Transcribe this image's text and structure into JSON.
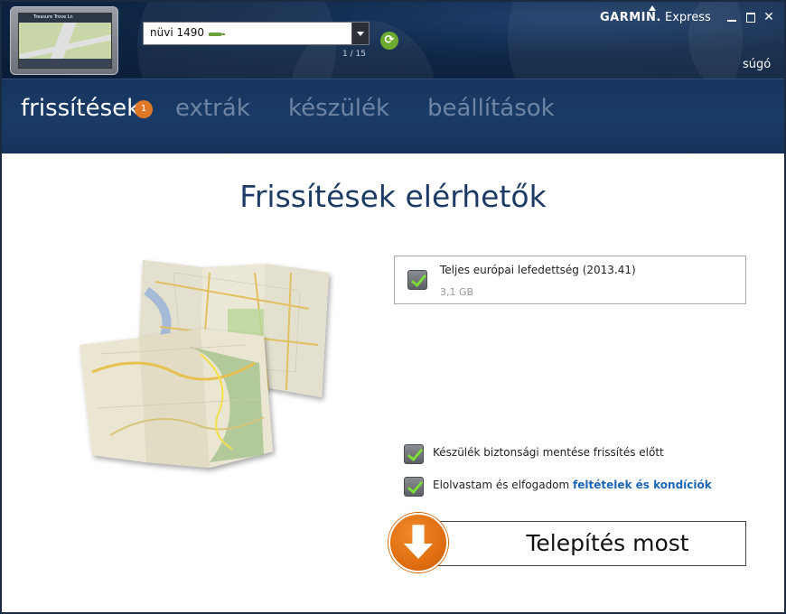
{
  "header": {
    "device_name": "nüvi 1490",
    "device_count": "1 / 15",
    "brand_name": "GARMIN.",
    "brand_product": "Express",
    "help_label": "súgó",
    "device_thumb_text": "Treasure Trove Ln"
  },
  "nav": {
    "tabs": [
      {
        "label": "frissítések",
        "active": true
      },
      {
        "label": "extrák",
        "active": false
      },
      {
        "label": "készülék",
        "active": false
      },
      {
        "label": "beállítások",
        "active": false
      }
    ],
    "updates_badge": "1"
  },
  "main": {
    "title": "Frissítések elérhetők",
    "update_item": {
      "name": "Teljes európai lefedettség (2013.41)",
      "size": "3,1 GB",
      "checked": true
    },
    "backup_option": {
      "label": "Készülék biztonsági mentése frissítés előtt",
      "checked": true
    },
    "terms_option": {
      "prefix": "Elolvastam és elfogadom ",
      "link": "feltételek és kondíciók",
      "checked": true
    },
    "install_button": "Telepítés most"
  },
  "colors": {
    "header_bg": "#0f2748",
    "nav_bg": "#1a3b67",
    "accent_orange": "#e06f10",
    "title_blue": "#1b3a64",
    "link_blue": "#1d66b5",
    "check_green": "#7ddc3a",
    "sync_green": "#6cab2d"
  },
  "icons": {
    "sync": "refresh-icon",
    "install": "download-arrow-icon",
    "device_plug": "usb-plug-icon"
  }
}
